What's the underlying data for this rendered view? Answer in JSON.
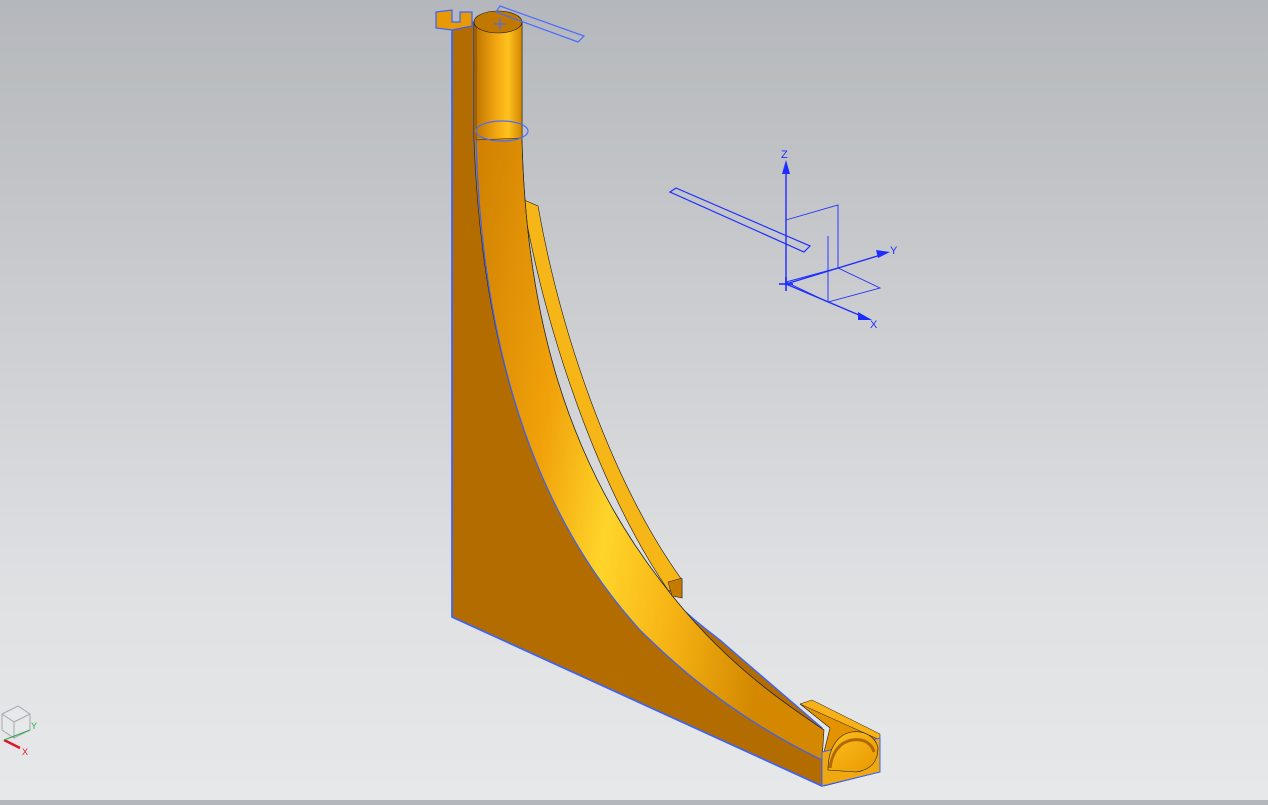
{
  "viewport": {
    "background_top": "#b4b7bb",
    "background_bottom": "#e6e8ea"
  },
  "model": {
    "face_color_dark": "#b46d00",
    "face_color_mid": "#e89a06",
    "face_color_light": "#ffd020",
    "edge_color": "#3a63ff"
  },
  "datum_csys": {
    "x_label": "X",
    "y_label": "Y",
    "z_label": "Z",
    "color": "#1e2cff"
  },
  "view_triad": {
    "x_label": "X",
    "y_label": "Y",
    "x_color": "#e0162b",
    "y_color": "#32a852",
    "z_color": "#8a8a8a"
  }
}
